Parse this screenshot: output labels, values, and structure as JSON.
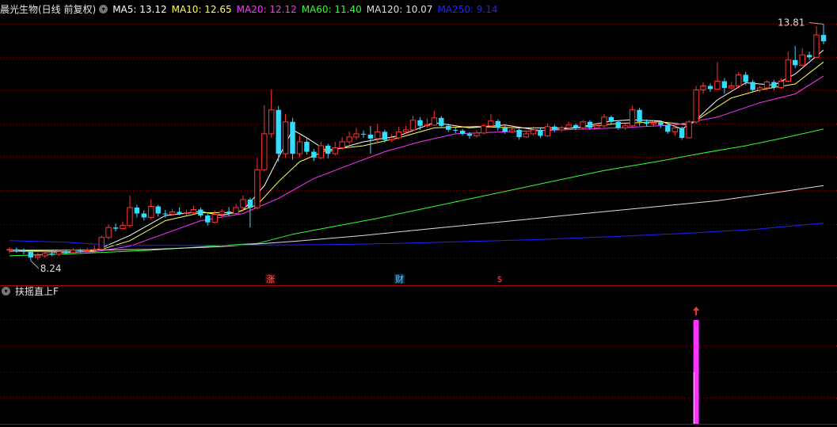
{
  "header": {
    "stock_name": "晨光生物(日线 前复权)",
    "ma_lines": [
      {
        "label": "MA5: 13.12",
        "color": "#ffffff"
      },
      {
        "label": "MA10: 12.65",
        "color": "#ffff55"
      },
      {
        "label": "MA20: 12.12",
        "color": "#ff33ff"
      },
      {
        "label": "MA60: 11.40",
        "color": "#33ff33"
      },
      {
        "label": "MA120: 10.07",
        "color": "#dddddd"
      },
      {
        "label": "MA250: 9.14",
        "color": "#2222ff"
      }
    ]
  },
  "indicator": {
    "name": "扶摇直上F"
  },
  "markers": {
    "zhang": "涨",
    "cai": "财",
    "dollar": "$"
  },
  "colors": {
    "up": "#ff3333",
    "down": "#33ddff",
    "grid": "#800000",
    "signal": "#ff33ff",
    "arrow": "#ff3030"
  },
  "chart_data": {
    "type": "candlestick",
    "x_unit": "trading days",
    "price_range": [
      8.0,
      14.2
    ],
    "high_label": "13.81",
    "low_label": "8.24",
    "candles": [
      [
        8.48,
        8.5,
        8.55,
        8.4
      ],
      [
        8.5,
        8.47,
        8.55,
        8.42
      ],
      [
        8.47,
        8.44,
        8.52,
        8.38
      ],
      [
        8.44,
        8.3,
        8.46,
        8.22
      ],
      [
        8.3,
        8.34,
        8.42,
        8.24
      ],
      [
        8.34,
        8.4,
        8.46,
        8.3
      ],
      [
        8.4,
        8.38,
        8.45,
        8.33
      ],
      [
        8.38,
        8.44,
        8.48,
        8.34
      ],
      [
        8.44,
        8.42,
        8.5,
        8.38
      ],
      [
        8.42,
        8.48,
        8.53,
        8.4
      ],
      [
        8.48,
        8.46,
        8.52,
        8.42
      ],
      [
        8.46,
        8.48,
        8.54,
        8.43
      ],
      [
        8.48,
        8.5,
        8.6,
        8.45
      ],
      [
        8.5,
        8.8,
        8.85,
        8.48
      ],
      [
        8.8,
        9.05,
        9.12,
        8.75
      ],
      [
        9.05,
        9.02,
        9.15,
        8.95
      ],
      [
        9.02,
        9.1,
        9.2,
        9.0
      ],
      [
        9.1,
        9.55,
        9.85,
        9.05
      ],
      [
        9.55,
        9.4,
        9.62,
        9.3
      ],
      [
        9.4,
        9.3,
        9.48,
        9.22
      ],
      [
        9.3,
        9.58,
        9.75,
        9.25
      ],
      [
        9.58,
        9.4,
        9.62,
        9.32
      ],
      [
        9.4,
        9.38,
        9.48,
        9.3
      ],
      [
        9.38,
        9.44,
        9.52,
        9.35
      ],
      [
        9.44,
        9.4,
        9.55,
        9.36
      ],
      [
        9.4,
        9.42,
        9.5,
        9.36
      ],
      [
        9.42,
        9.5,
        9.6,
        9.38
      ],
      [
        9.5,
        9.35,
        9.55,
        9.3
      ],
      [
        9.35,
        9.18,
        9.4,
        9.1
      ],
      [
        9.18,
        9.38,
        9.48,
        9.15
      ],
      [
        9.38,
        9.45,
        9.52,
        9.33
      ],
      [
        9.45,
        9.4,
        9.56,
        9.35
      ],
      [
        9.4,
        9.55,
        9.64,
        9.38
      ],
      [
        9.55,
        9.75,
        9.86,
        9.45
      ],
      [
        9.75,
        9.55,
        9.8,
        9.05
      ],
      [
        9.55,
        10.5,
        10.8,
        9.5
      ],
      [
        10.5,
        11.4,
        12.12,
        10.45
      ],
      [
        11.4,
        12.0,
        12.5,
        11.3
      ],
      [
        12.0,
        10.9,
        12.1,
        10.7
      ],
      [
        10.9,
        11.7,
        11.9,
        10.8
      ],
      [
        11.7,
        10.9,
        11.8,
        10.75
      ],
      [
        10.9,
        11.2,
        11.35,
        10.82
      ],
      [
        11.2,
        10.95,
        11.3,
        10.88
      ],
      [
        10.95,
        10.8,
        11.02,
        10.72
      ],
      [
        10.8,
        11.1,
        11.2,
        10.76
      ],
      [
        11.1,
        10.9,
        11.15,
        10.78
      ],
      [
        10.9,
        11.05,
        11.2,
        10.86
      ],
      [
        11.05,
        11.2,
        11.32,
        11.0
      ],
      [
        11.2,
        11.32,
        11.46,
        11.14
      ],
      [
        11.32,
        11.4,
        11.55,
        11.25
      ],
      [
        11.4,
        11.38,
        11.48,
        11.3
      ],
      [
        11.38,
        11.28,
        11.6,
        10.9
      ],
      [
        11.28,
        11.45,
        11.65,
        11.2
      ],
      [
        11.45,
        11.25,
        11.5,
        11.18
      ],
      [
        11.25,
        11.3,
        11.4,
        11.2
      ],
      [
        11.3,
        11.45,
        11.58,
        11.26
      ],
      [
        11.45,
        11.5,
        11.6,
        11.4
      ],
      [
        11.5,
        11.74,
        11.85,
        11.45
      ],
      [
        11.74,
        11.6,
        11.82,
        11.5
      ],
      [
        11.6,
        11.62,
        11.78,
        11.55
      ],
      [
        11.62,
        11.8,
        11.98,
        11.6
      ],
      [
        11.8,
        11.6,
        11.85,
        11.55
      ],
      [
        11.6,
        11.5,
        11.66,
        11.45
      ],
      [
        11.5,
        11.48,
        11.56,
        11.42
      ],
      [
        11.48,
        11.4,
        11.52,
        11.35
      ],
      [
        11.4,
        11.35,
        11.44,
        11.28
      ],
      [
        11.35,
        11.42,
        11.5,
        11.3
      ],
      [
        11.42,
        11.6,
        11.65,
        11.38
      ],
      [
        11.6,
        11.72,
        11.9,
        11.55
      ],
      [
        11.72,
        11.55,
        11.76,
        11.48
      ],
      [
        11.55,
        11.45,
        11.6,
        11.4
      ],
      [
        11.45,
        11.5,
        11.55,
        11.42
      ],
      [
        11.5,
        11.32,
        11.54,
        11.25
      ],
      [
        11.32,
        11.4,
        11.48,
        11.3
      ],
      [
        11.4,
        11.5,
        11.58,
        11.35
      ],
      [
        11.5,
        11.35,
        11.55,
        11.3
      ],
      [
        11.35,
        11.58,
        11.66,
        11.32
      ],
      [
        11.58,
        11.5,
        11.63,
        11.44
      ],
      [
        11.5,
        11.55,
        11.6,
        11.45
      ],
      [
        11.55,
        11.62,
        11.7,
        11.5
      ],
      [
        11.62,
        11.55,
        11.66,
        11.5
      ],
      [
        11.55,
        11.7,
        11.75,
        11.5
      ],
      [
        11.7,
        11.55,
        11.74,
        11.5
      ],
      [
        11.55,
        11.6,
        11.68,
        11.52
      ],
      [
        11.6,
        11.82,
        11.9,
        11.56
      ],
      [
        11.82,
        11.7,
        11.86,
        11.62
      ],
      [
        11.7,
        11.55,
        11.74,
        11.5
      ],
      [
        11.55,
        11.6,
        11.66,
        11.5
      ],
      [
        11.6,
        12.0,
        12.1,
        11.58
      ],
      [
        12.0,
        11.7,
        12.05,
        11.6
      ],
      [
        11.7,
        11.65,
        11.76,
        11.58
      ],
      [
        11.65,
        11.68,
        11.75,
        11.6
      ],
      [
        11.68,
        11.62,
        11.72,
        11.55
      ],
      [
        11.62,
        11.45,
        11.66,
        11.4
      ],
      [
        11.45,
        11.55,
        11.6,
        11.35
      ],
      [
        11.55,
        11.3,
        11.58,
        11.25
      ],
      [
        11.3,
        11.7,
        11.75,
        11.28
      ],
      [
        11.7,
        12.5,
        12.6,
        11.65
      ],
      [
        12.5,
        12.6,
        12.7,
        12.4
      ],
      [
        12.6,
        12.52,
        12.66,
        12.45
      ],
      [
        12.52,
        12.72,
        13.2,
        12.5
      ],
      [
        12.72,
        12.55,
        12.8,
        12.4
      ],
      [
        12.55,
        12.6,
        12.7,
        12.5
      ],
      [
        12.6,
        12.88,
        12.95,
        12.55
      ],
      [
        12.88,
        12.7,
        12.95,
        12.62
      ],
      [
        12.7,
        12.5,
        12.75,
        12.45
      ],
      [
        12.5,
        12.55,
        12.6,
        12.45
      ],
      [
        12.55,
        12.7,
        12.74,
        12.5
      ],
      [
        12.7,
        12.56,
        12.75,
        12.5
      ],
      [
        12.56,
        12.72,
        12.8,
        12.52
      ],
      [
        12.72,
        13.25,
        13.45,
        12.7
      ],
      [
        13.25,
        13.12,
        13.6,
        13.05
      ],
      [
        13.12,
        13.38,
        13.55,
        13.1
      ],
      [
        13.38,
        13.32,
        13.46,
        13.25
      ],
      [
        13.32,
        13.88,
        14.1,
        13.3
      ],
      [
        13.88,
        13.72,
        14.15,
        13.65
      ]
    ],
    "ma_series": [
      {
        "name": "MA5",
        "points": [
          [
            0,
            8.48
          ],
          [
            8,
            8.42
          ],
          [
            12,
            8.46
          ],
          [
            17,
            8.85
          ],
          [
            22,
            9.35
          ],
          [
            27,
            9.45
          ],
          [
            30,
            9.35
          ],
          [
            33,
            9.48
          ],
          [
            36,
            10.1
          ],
          [
            38,
            10.8
          ],
          [
            40,
            11.5
          ],
          [
            42,
            11.3
          ],
          [
            45,
            10.95
          ],
          [
            50,
            11.2
          ],
          [
            55,
            11.35
          ],
          [
            60,
            11.68
          ],
          [
            65,
            11.55
          ],
          [
            70,
            11.62
          ],
          [
            75,
            11.48
          ],
          [
            80,
            11.55
          ],
          [
            85,
            11.72
          ],
          [
            88,
            11.75
          ],
          [
            92,
            11.72
          ],
          [
            95,
            11.52
          ],
          [
            97,
            11.75
          ],
          [
            100,
            12.25
          ],
          [
            104,
            12.68
          ],
          [
            108,
            12.62
          ],
          [
            111,
            12.9
          ],
          [
            115,
            13.5
          ]
        ]
      },
      {
        "name": "MA10",
        "points": [
          [
            0,
            8.48
          ],
          [
            10,
            8.44
          ],
          [
            13,
            8.5
          ],
          [
            17,
            8.72
          ],
          [
            22,
            9.22
          ],
          [
            27,
            9.42
          ],
          [
            32,
            9.42
          ],
          [
            35,
            9.62
          ],
          [
            38,
            10.2
          ],
          [
            41,
            10.7
          ],
          [
            45,
            11.0
          ],
          [
            50,
            11.1
          ],
          [
            55,
            11.3
          ],
          [
            60,
            11.55
          ],
          [
            66,
            11.58
          ],
          [
            72,
            11.55
          ],
          [
            80,
            11.55
          ],
          [
            86,
            11.66
          ],
          [
            92,
            11.7
          ],
          [
            96,
            11.62
          ],
          [
            98,
            11.85
          ],
          [
            102,
            12.3
          ],
          [
            106,
            12.5
          ],
          [
            111,
            12.65
          ],
          [
            115,
            13.2
          ]
        ]
      },
      {
        "name": "MA20",
        "points": [
          [
            0,
            8.45
          ],
          [
            12,
            8.44
          ],
          [
            17,
            8.58
          ],
          [
            22,
            8.9
          ],
          [
            27,
            9.22
          ],
          [
            33,
            9.4
          ],
          [
            38,
            9.78
          ],
          [
            43,
            10.28
          ],
          [
            48,
            10.62
          ],
          [
            53,
            10.95
          ],
          [
            58,
            11.2
          ],
          [
            63,
            11.4
          ],
          [
            70,
            11.45
          ],
          [
            78,
            11.5
          ],
          [
            86,
            11.55
          ],
          [
            94,
            11.62
          ],
          [
            100,
            11.82
          ],
          [
            106,
            12.18
          ],
          [
            111,
            12.4
          ],
          [
            115,
            12.85
          ]
        ]
      },
      {
        "name": "MA60",
        "points": [
          [
            0,
            8.34
          ],
          [
            10,
            8.4
          ],
          [
            20,
            8.48
          ],
          [
            30,
            8.6
          ],
          [
            35,
            8.65
          ],
          [
            40,
            8.88
          ],
          [
            45,
            9.05
          ],
          [
            52,
            9.28
          ],
          [
            60,
            9.58
          ],
          [
            68,
            9.88
          ],
          [
            76,
            10.18
          ],
          [
            84,
            10.48
          ],
          [
            92,
            10.72
          ],
          [
            98,
            10.92
          ],
          [
            104,
            11.1
          ],
          [
            110,
            11.32
          ],
          [
            115,
            11.52
          ]
        ]
      },
      {
        "name": "MA120",
        "points": [
          [
            0,
            8.48
          ],
          [
            10,
            8.48
          ],
          [
            20,
            8.5
          ],
          [
            30,
            8.57
          ],
          [
            40,
            8.7
          ],
          [
            50,
            8.85
          ],
          [
            60,
            9.03
          ],
          [
            70,
            9.2
          ],
          [
            80,
            9.38
          ],
          [
            90,
            9.55
          ],
          [
            100,
            9.72
          ],
          [
            108,
            9.92
          ],
          [
            115,
            10.1
          ]
        ]
      },
      {
        "name": "MA250",
        "points": [
          [
            0,
            8.72
          ],
          [
            8,
            8.68
          ],
          [
            15,
            8.6
          ],
          [
            25,
            8.6
          ],
          [
            35,
            8.61
          ],
          [
            45,
            8.62
          ],
          [
            55,
            8.65
          ],
          [
            65,
            8.7
          ],
          [
            75,
            8.75
          ],
          [
            85,
            8.82
          ],
          [
            95,
            8.9
          ],
          [
            105,
            9.0
          ],
          [
            115,
            9.16
          ]
        ]
      }
    ],
    "indicator_bars": [
      {
        "index": 97,
        "value": 1
      }
    ]
  }
}
